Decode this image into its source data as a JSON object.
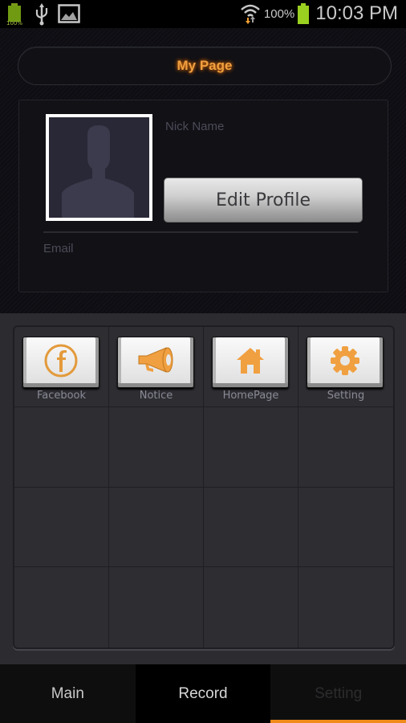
{
  "status_bar": {
    "left_icons": [
      "battery-notification-icon",
      "usb-icon",
      "image-icon"
    ],
    "battery_notification_text": "100%",
    "wifi_icon": "wifi-icon",
    "battery_percent": "100%",
    "battery_icon": "battery-full-icon",
    "time": "10:03 PM"
  },
  "header": {
    "title": "My Page"
  },
  "profile": {
    "avatar_icon": "default-user-silhouette-icon",
    "nickname_label": "Nick Name",
    "edit_button_label": "Edit Profile",
    "email_label": "Email"
  },
  "grid": {
    "items": [
      {
        "label": "Facebook",
        "icon": "facebook-icon"
      },
      {
        "label": "Notice",
        "icon": "megaphone-icon"
      },
      {
        "label": "HomePage",
        "icon": "home-icon"
      },
      {
        "label": "Setting",
        "icon": "gear-icon"
      }
    ],
    "empty_cells": 12
  },
  "tabs": [
    {
      "label": "Main",
      "selected": false
    },
    {
      "label": "Record",
      "selected": false
    },
    {
      "label": "Setting",
      "selected": true
    }
  ],
  "colors": {
    "accent": "#f08a18",
    "icon_orange": "#f0a040",
    "title_orange": "#f0a040"
  }
}
